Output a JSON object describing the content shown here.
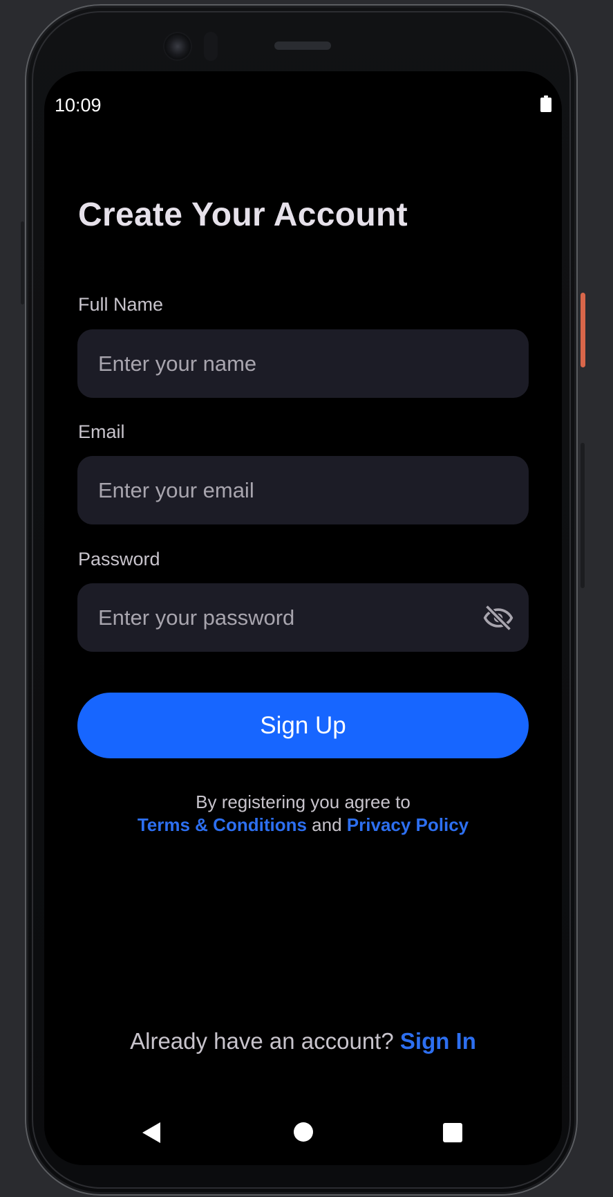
{
  "status_bar": {
    "time": "10:09",
    "battery_icon": "battery-full-icon"
  },
  "form": {
    "title": "Create Your Account",
    "full_name": {
      "label": "Full Name",
      "placeholder": "Enter your name",
      "value": ""
    },
    "email": {
      "label": "Email",
      "placeholder": "Enter your email",
      "value": ""
    },
    "password": {
      "label": "Password",
      "placeholder": "Enter your password",
      "value": "",
      "toggle_icon": "eye-off-icon"
    },
    "signup_button_label": "Sign Up"
  },
  "terms": {
    "prefix": "By registering you agree to",
    "terms_link": "Terms & Conditions",
    "conjunction": "and",
    "privacy_link": "Privacy Policy"
  },
  "signin": {
    "prompt": "Already have an account?",
    "link": "Sign In"
  },
  "nav_bar": {
    "back_icon": "back-triangle-icon",
    "home_icon": "home-circle-icon",
    "recents_icon": "recents-square-icon"
  },
  "colors": {
    "background": "#000000",
    "input_background": "#1c1c26",
    "accent": "#1766ff",
    "link": "#2d6ff0",
    "title_text": "#e6e1ea",
    "muted_text": "#c8c4cc"
  }
}
